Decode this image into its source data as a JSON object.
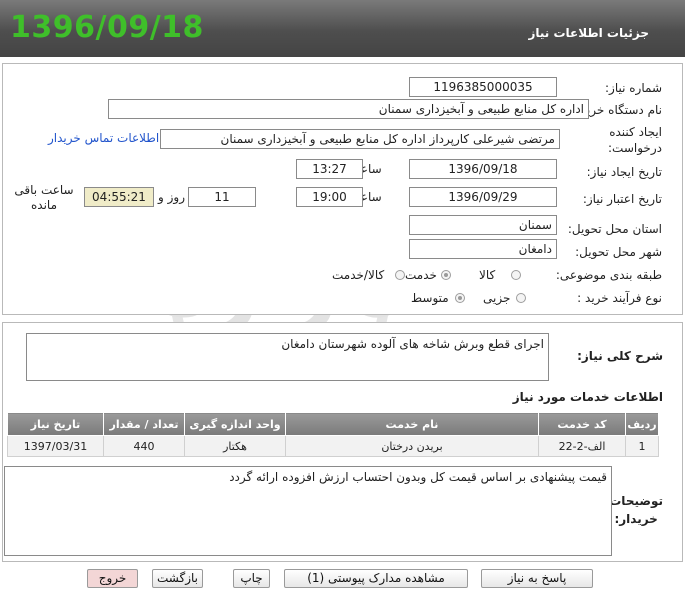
{
  "header": {
    "date": "1396/09/18",
    "title": "جزئیات اطلاعات نیاز"
  },
  "form": {
    "need_number_label": "شماره نیاز:",
    "need_number": "1196385000035",
    "buyer_org_label": "نام دستگاه خریدار:",
    "buyer_org": "اداره کل منابع طبیعی و آبخیزداری سمنان",
    "requester_label_1": "ایجاد کننده",
    "requester_label_2": "درخواست:",
    "requester": "مرتضی شیرعلی کارپرداز اداره کل منابع طبیعی و آبخیزداری سمنان",
    "contact_link": "اطلاعات تماس خریدار",
    "create_date_label": "تاریخ ایجاد نیاز:",
    "create_date": "1396/09/18",
    "time_label": "ساعت",
    "create_time": "13:27",
    "valid_date_label": "تاریخ اعتبار نیاز:",
    "valid_date": "1396/09/29",
    "valid_time": "19:00",
    "days": "11",
    "days_label": "روز و",
    "remaining": "04:55:21",
    "remaining_label": "ساعت باقی مانده",
    "province_label": "استان محل تحویل:",
    "province": "سمنان",
    "city_label": "شهر محل تحویل:",
    "city": "دامغان",
    "category_label": "طبقه بندی موضوعی:",
    "category_options": [
      "کالا",
      "خدمت",
      "کالا/خدمت"
    ],
    "category_selected": "خدمت",
    "process_label": "نوع فرآیند خرید :",
    "process_options": [
      "جزیی",
      "متوسط"
    ],
    "process_selected": "متوسط"
  },
  "summary": {
    "label": "شرح کلی نیاز:",
    "text": "اجرای قطع وبرش شاخه های آلوده شهرستان دامغان"
  },
  "services": {
    "title": "اطلاعات خدمات مورد نیاز",
    "columns": [
      "ردیف",
      "کد خدمت",
      "نام خدمت",
      "واحد اندازه گیری",
      "تعداد / مقدار",
      "تاریخ نیاز"
    ],
    "rows": [
      [
        "1",
        "الف-2-22",
        "بریدن درختان",
        "هکتار",
        "440",
        "1397/03/31"
      ]
    ]
  },
  "notes": {
    "label_1": "توضیحات",
    "label_2": "خریدار:",
    "text": "قیمت پیشنهادی بر اساس قیمت کل وبدون احتساب ارزش افزوده ارائه گردد"
  },
  "buttons": {
    "reply": "پاسخ به نیاز",
    "attachments": "مشاهده مدارک پیوستی (1)",
    "print": "چاپ",
    "back": "بازگشت",
    "exit": "خروج"
  },
  "colors": {
    "date": "#3fbf2a",
    "header": "#5a5a5a",
    "link": "#2255cc",
    "remaining_bg": "#f0ecc8"
  }
}
